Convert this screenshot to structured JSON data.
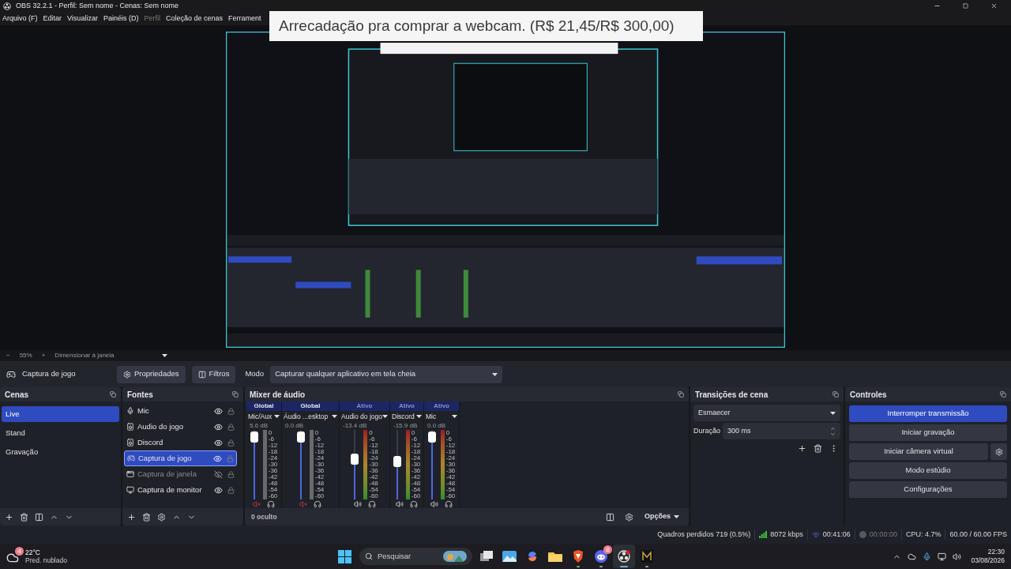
{
  "window": {
    "title": "OBS 32.2.1 - Perfil: Sem nome - Cenas: Sem nome"
  },
  "menu": [
    {
      "label": "Arquivo (F)",
      "disabled": false
    },
    {
      "label": "Editar",
      "disabled": false
    },
    {
      "label": "Visualizar",
      "disabled": false
    },
    {
      "label": "Painéis (D)",
      "disabled": false
    },
    {
      "label": "Perfil",
      "disabled": true
    },
    {
      "label": "Coleção de cenas",
      "disabled": false
    },
    {
      "label": "Ferrament",
      "disabled": false
    }
  ],
  "overlay_banner": {
    "text": "Arrecadação pra comprar a webcam. (R$ 21,45/R$ 300,00)"
  },
  "zoom_bar": {
    "zoom_out": "−",
    "zoom": "55%",
    "zoom_in": "+",
    "fit": "Dimensionar à janela"
  },
  "source_toolbar": {
    "source": "Captura de jogo",
    "properties": "Propriedades",
    "filters": "Filtros",
    "mode_label": "Modo",
    "mode_value": "Capturar qualquer aplicativo em tela cheia"
  },
  "scenes": {
    "title": "Cenas",
    "items": [
      {
        "label": "Live",
        "selected": true
      },
      {
        "label": "Stand",
        "selected": false
      },
      {
        "label": "Gravação",
        "selected": false
      }
    ]
  },
  "sources": {
    "title": "Fontes",
    "items": [
      {
        "label": "Mic",
        "kind": "mic",
        "visible": true,
        "selected": false
      },
      {
        "label": "Audio do jogo",
        "kind": "audio",
        "visible": true,
        "selected": false
      },
      {
        "label": "Discord",
        "kind": "audio",
        "visible": true,
        "selected": false
      },
      {
        "label": "Captura de jogo",
        "kind": "game",
        "visible": true,
        "selected": true
      },
      {
        "label": "Captura de janela",
        "kind": "window",
        "visible": false,
        "selected": false
      },
      {
        "label": "Captura de monitor",
        "kind": "monitor",
        "visible": true,
        "selected": false
      }
    ]
  },
  "mixer": {
    "title": "Mixer de áudio",
    "hidden_count": "0 oculto",
    "options": "Opções",
    "channels": [
      {
        "badge": "Global",
        "global": true,
        "name": "Mic/Aux",
        "reading": "5.6 dB",
        "level": 0.97,
        "muted": true,
        "scale": [
          "0",
          "-6",
          "-12",
          "-18",
          "-24",
          "-30",
          "-36",
          "-42",
          "-48",
          "-54",
          "-60"
        ]
      },
      {
        "badge": "Global",
        "global": true,
        "name": "Áudio ...esktop",
        "reading": "0.0 dB",
        "level": 0.97,
        "muted": true,
        "scale": [
          "0",
          "-6",
          "-12",
          "-18",
          "-24",
          "-30",
          "-36",
          "-42",
          "-48",
          "-54",
          "-60"
        ]
      },
      {
        "badge": "Ativo",
        "global": false,
        "name": "Audio do jogo",
        "reading": "-13.4 dB",
        "level": 0.6,
        "muted": false,
        "scale": [
          "0",
          "-6",
          "-12",
          "-18",
          "-24",
          "-30",
          "-36",
          "-42",
          "-48",
          "-54",
          "-60"
        ]
      },
      {
        "badge": "Ativo",
        "global": false,
        "name": "Discord",
        "reading": "-15.9 dB",
        "level": 0.55,
        "muted": false,
        "scale": [
          "0",
          "-6",
          "-12",
          "-18",
          "-24",
          "-30",
          "-36",
          "-42",
          "-48",
          "-54",
          "-60"
        ]
      },
      {
        "badge": "Ativo",
        "global": false,
        "name": "Mic",
        "reading": "0.0 dB",
        "level": 0.97,
        "muted": false,
        "scale": [
          "0",
          "-6",
          "-12",
          "-18",
          "-24",
          "-30",
          "-36",
          "-42",
          "-48",
          "-54",
          "-60"
        ]
      }
    ]
  },
  "transitions": {
    "title": "Transições de cena",
    "type": "Esmaecer",
    "duration_label": "Duração",
    "duration": "300 ms"
  },
  "controls": {
    "title": "Controles",
    "buttons": [
      {
        "label": "Interromper transmissão",
        "active": true,
        "settings": false
      },
      {
        "label": "Iniciar gravação",
        "active": false,
        "settings": false
      },
      {
        "label": "Iniciar câmera virtual",
        "active": false,
        "settings": true
      },
      {
        "label": "Modo estúdio",
        "active": false,
        "settings": false
      },
      {
        "label": "Configurações",
        "active": false,
        "settings": false
      }
    ]
  },
  "status_bar": {
    "dropped": "Quadros perdidos 719 (0.5%)",
    "bitrate": "8072 kbps",
    "stream_time": "00:41:06",
    "record_time": "00:00:00",
    "recording": false,
    "cpu": "CPU: 4.7%",
    "fps": "60.00 / 60.00 FPS"
  },
  "taskbar": {
    "weather": {
      "temp": "22°C",
      "desc": "Pred. nublado",
      "badge": "4"
    },
    "search": {
      "placeholder": "Pesquisar"
    },
    "apps": [
      {
        "kind": "taskview",
        "running": false,
        "active": false
      },
      {
        "kind": "photos",
        "running": false,
        "active": false
      },
      {
        "kind": "swirl",
        "running": false,
        "active": false
      },
      {
        "kind": "folder",
        "running": false,
        "active": false
      },
      {
        "kind": "shield",
        "running": true,
        "active": false
      },
      {
        "kind": "chat",
        "running": true,
        "active": false,
        "badge": "8"
      },
      {
        "kind": "aperture",
        "running": true,
        "active": true
      },
      {
        "kind": "square",
        "running": true,
        "active": false
      }
    ],
    "clock": {
      "time": "22:30",
      "date": "03/08/2026"
    }
  }
}
